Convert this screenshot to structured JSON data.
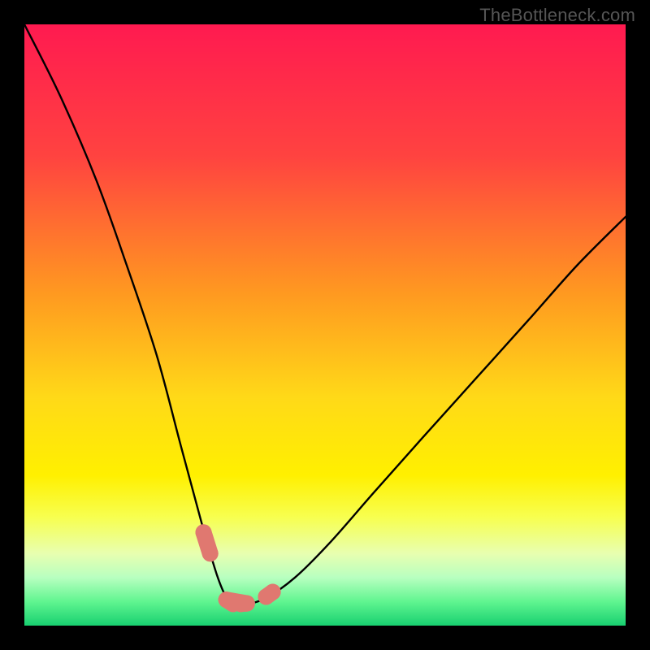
{
  "watermark": "TheBottleneck.com",
  "chart_data": {
    "type": "line",
    "title": "",
    "xlabel": "",
    "ylabel": "",
    "xlim": [
      0,
      100
    ],
    "ylim": [
      0,
      100
    ],
    "background_gradient_stops": [
      {
        "offset": 0,
        "color": "#ff1a50"
      },
      {
        "offset": 22,
        "color": "#ff4340"
      },
      {
        "offset": 45,
        "color": "#ff9a20"
      },
      {
        "offset": 62,
        "color": "#ffd918"
      },
      {
        "offset": 75,
        "color": "#fff000"
      },
      {
        "offset": 82,
        "color": "#f7ff50"
      },
      {
        "offset": 88,
        "color": "#e8ffb0"
      },
      {
        "offset": 92,
        "color": "#b8ffc0"
      },
      {
        "offset": 96,
        "color": "#60f590"
      },
      {
        "offset": 100,
        "color": "#18d070"
      }
    ],
    "series": [
      {
        "name": "bottleneck-curve",
        "x": [
          0,
          6,
          12,
          17,
          22,
          26,
          29.5,
          32,
          33.7,
          35,
          36.5,
          40,
          45,
          51,
          58,
          66,
          75,
          84,
          92,
          100
        ],
        "y": [
          100,
          88,
          74,
          60,
          45,
          30,
          17,
          8.5,
          4.5,
          3.5,
          3.5,
          4.5,
          8,
          14,
          22,
          31,
          41,
          51,
          60,
          68
        ]
      }
    ],
    "markers": {
      "name": "highlighted-points",
      "color": "#e07870",
      "stroke": "#a84a40",
      "x": [
        29.8,
        30.9,
        33.6,
        34.7,
        36.0,
        37.0,
        40.2,
        41.3
      ],
      "y": [
        15.5,
        12.0,
        4.3,
        3.6,
        3.6,
        3.7,
        4.8,
        5.6
      ]
    }
  }
}
